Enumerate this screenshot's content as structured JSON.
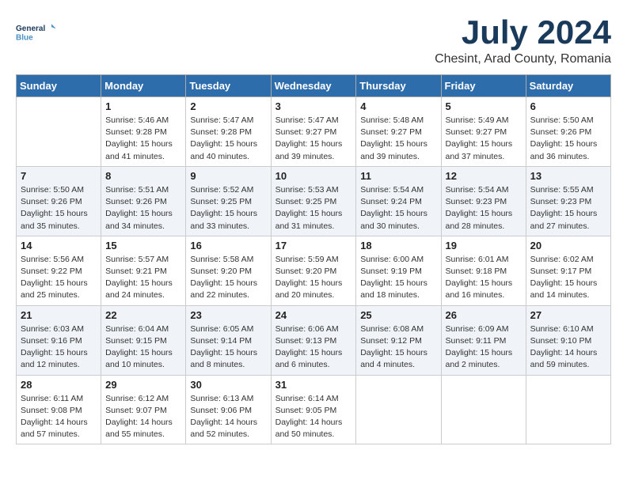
{
  "header": {
    "logo_line1": "General",
    "logo_line2": "Blue",
    "month": "July 2024",
    "location": "Chesint, Arad County, Romania"
  },
  "weekdays": [
    "Sunday",
    "Monday",
    "Tuesday",
    "Wednesday",
    "Thursday",
    "Friday",
    "Saturday"
  ],
  "weeks": [
    [
      {
        "day": "",
        "sunrise": "",
        "sunset": "",
        "daylight": ""
      },
      {
        "day": "1",
        "sunrise": "Sunrise: 5:46 AM",
        "sunset": "Sunset: 9:28 PM",
        "daylight": "Daylight: 15 hours and 41 minutes."
      },
      {
        "day": "2",
        "sunrise": "Sunrise: 5:47 AM",
        "sunset": "Sunset: 9:28 PM",
        "daylight": "Daylight: 15 hours and 40 minutes."
      },
      {
        "day": "3",
        "sunrise": "Sunrise: 5:47 AM",
        "sunset": "Sunset: 9:27 PM",
        "daylight": "Daylight: 15 hours and 39 minutes."
      },
      {
        "day": "4",
        "sunrise": "Sunrise: 5:48 AM",
        "sunset": "Sunset: 9:27 PM",
        "daylight": "Daylight: 15 hours and 39 minutes."
      },
      {
        "day": "5",
        "sunrise": "Sunrise: 5:49 AM",
        "sunset": "Sunset: 9:27 PM",
        "daylight": "Daylight: 15 hours and 37 minutes."
      },
      {
        "day": "6",
        "sunrise": "Sunrise: 5:50 AM",
        "sunset": "Sunset: 9:26 PM",
        "daylight": "Daylight: 15 hours and 36 minutes."
      }
    ],
    [
      {
        "day": "7",
        "sunrise": "Sunrise: 5:50 AM",
        "sunset": "Sunset: 9:26 PM",
        "daylight": "Daylight: 15 hours and 35 minutes."
      },
      {
        "day": "8",
        "sunrise": "Sunrise: 5:51 AM",
        "sunset": "Sunset: 9:26 PM",
        "daylight": "Daylight: 15 hours and 34 minutes."
      },
      {
        "day": "9",
        "sunrise": "Sunrise: 5:52 AM",
        "sunset": "Sunset: 9:25 PM",
        "daylight": "Daylight: 15 hours and 33 minutes."
      },
      {
        "day": "10",
        "sunrise": "Sunrise: 5:53 AM",
        "sunset": "Sunset: 9:25 PM",
        "daylight": "Daylight: 15 hours and 31 minutes."
      },
      {
        "day": "11",
        "sunrise": "Sunrise: 5:54 AM",
        "sunset": "Sunset: 9:24 PM",
        "daylight": "Daylight: 15 hours and 30 minutes."
      },
      {
        "day": "12",
        "sunrise": "Sunrise: 5:54 AM",
        "sunset": "Sunset: 9:23 PM",
        "daylight": "Daylight: 15 hours and 28 minutes."
      },
      {
        "day": "13",
        "sunrise": "Sunrise: 5:55 AM",
        "sunset": "Sunset: 9:23 PM",
        "daylight": "Daylight: 15 hours and 27 minutes."
      }
    ],
    [
      {
        "day": "14",
        "sunrise": "Sunrise: 5:56 AM",
        "sunset": "Sunset: 9:22 PM",
        "daylight": "Daylight: 15 hours and 25 minutes."
      },
      {
        "day": "15",
        "sunrise": "Sunrise: 5:57 AM",
        "sunset": "Sunset: 9:21 PM",
        "daylight": "Daylight: 15 hours and 24 minutes."
      },
      {
        "day": "16",
        "sunrise": "Sunrise: 5:58 AM",
        "sunset": "Sunset: 9:20 PM",
        "daylight": "Daylight: 15 hours and 22 minutes."
      },
      {
        "day": "17",
        "sunrise": "Sunrise: 5:59 AM",
        "sunset": "Sunset: 9:20 PM",
        "daylight": "Daylight: 15 hours and 20 minutes."
      },
      {
        "day": "18",
        "sunrise": "Sunrise: 6:00 AM",
        "sunset": "Sunset: 9:19 PM",
        "daylight": "Daylight: 15 hours and 18 minutes."
      },
      {
        "day": "19",
        "sunrise": "Sunrise: 6:01 AM",
        "sunset": "Sunset: 9:18 PM",
        "daylight": "Daylight: 15 hours and 16 minutes."
      },
      {
        "day": "20",
        "sunrise": "Sunrise: 6:02 AM",
        "sunset": "Sunset: 9:17 PM",
        "daylight": "Daylight: 15 hours and 14 minutes."
      }
    ],
    [
      {
        "day": "21",
        "sunrise": "Sunrise: 6:03 AM",
        "sunset": "Sunset: 9:16 PM",
        "daylight": "Daylight: 15 hours and 12 minutes."
      },
      {
        "day": "22",
        "sunrise": "Sunrise: 6:04 AM",
        "sunset": "Sunset: 9:15 PM",
        "daylight": "Daylight: 15 hours and 10 minutes."
      },
      {
        "day": "23",
        "sunrise": "Sunrise: 6:05 AM",
        "sunset": "Sunset: 9:14 PM",
        "daylight": "Daylight: 15 hours and 8 minutes."
      },
      {
        "day": "24",
        "sunrise": "Sunrise: 6:06 AM",
        "sunset": "Sunset: 9:13 PM",
        "daylight": "Daylight: 15 hours and 6 minutes."
      },
      {
        "day": "25",
        "sunrise": "Sunrise: 6:08 AM",
        "sunset": "Sunset: 9:12 PM",
        "daylight": "Daylight: 15 hours and 4 minutes."
      },
      {
        "day": "26",
        "sunrise": "Sunrise: 6:09 AM",
        "sunset": "Sunset: 9:11 PM",
        "daylight": "Daylight: 15 hours and 2 minutes."
      },
      {
        "day": "27",
        "sunrise": "Sunrise: 6:10 AM",
        "sunset": "Sunset: 9:10 PM",
        "daylight": "Daylight: 14 hours and 59 minutes."
      }
    ],
    [
      {
        "day": "28",
        "sunrise": "Sunrise: 6:11 AM",
        "sunset": "Sunset: 9:08 PM",
        "daylight": "Daylight: 14 hours and 57 minutes."
      },
      {
        "day": "29",
        "sunrise": "Sunrise: 6:12 AM",
        "sunset": "Sunset: 9:07 PM",
        "daylight": "Daylight: 14 hours and 55 minutes."
      },
      {
        "day": "30",
        "sunrise": "Sunrise: 6:13 AM",
        "sunset": "Sunset: 9:06 PM",
        "daylight": "Daylight: 14 hours and 52 minutes."
      },
      {
        "day": "31",
        "sunrise": "Sunrise: 6:14 AM",
        "sunset": "Sunset: 9:05 PM",
        "daylight": "Daylight: 14 hours and 50 minutes."
      },
      {
        "day": "",
        "sunrise": "",
        "sunset": "",
        "daylight": ""
      },
      {
        "day": "",
        "sunrise": "",
        "sunset": "",
        "daylight": ""
      },
      {
        "day": "",
        "sunrise": "",
        "sunset": "",
        "daylight": ""
      }
    ]
  ]
}
